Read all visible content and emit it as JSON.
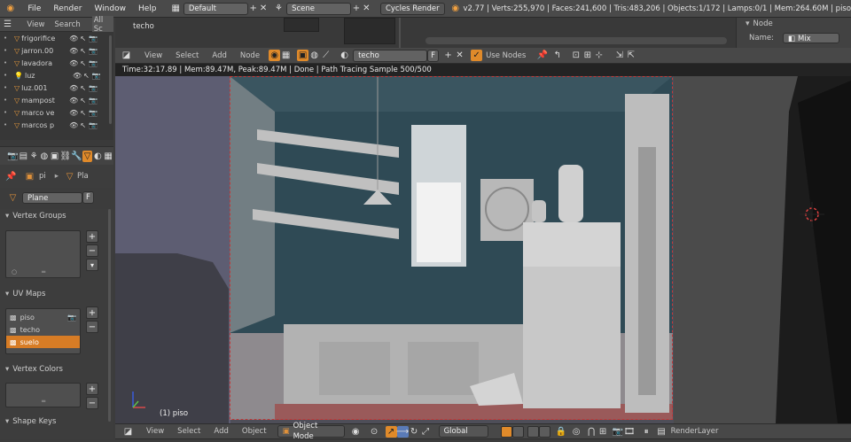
{
  "topbar": {
    "menus": [
      "File",
      "Render",
      "Window",
      "Help"
    ],
    "layout": "Default",
    "scene": "Scene",
    "engine": "Cycles Render",
    "stats": "v2.77 | Verts:255,970 | Faces:241,600 | Tris:483,206 | Objects:1/172 | Lamps:0/1 | Mem:264.60M | piso"
  },
  "outliner": {
    "menus": [
      "View",
      "Search",
      "All Sc"
    ],
    "items": [
      {
        "label": "frigorifice",
        "icon": "mesh-icon"
      },
      {
        "label": "jarron.00",
        "icon": "mesh-icon"
      },
      {
        "label": "lavadora",
        "icon": "mesh-icon"
      },
      {
        "label": "luz",
        "icon": "lamp-icon"
      },
      {
        "label": "luz.001",
        "icon": "mesh-icon"
      },
      {
        "label": "mampost",
        "icon": "mesh-icon"
      },
      {
        "label": "marco ve",
        "icon": "mesh-icon"
      },
      {
        "label": "marcos p",
        "icon": "mesh-icon"
      }
    ]
  },
  "properties": {
    "tab_labels": [
      "pi",
      "Pla"
    ],
    "object_name": "Plane",
    "fake_user": "F",
    "vertex_groups": "Vertex Groups",
    "uv_maps": "UV Maps",
    "uv_items": [
      {
        "label": "piso",
        "selected": false
      },
      {
        "label": "techo",
        "selected": false
      },
      {
        "label": "suelo",
        "selected": true
      }
    ],
    "vertex_colors": "Vertex Colors",
    "shape_keys": "Shape Keys"
  },
  "node_editor": {
    "node_label": "techo",
    "menus": [
      "View",
      "Select",
      "Add",
      "Node"
    ],
    "material": "techo",
    "fake_user": "F",
    "use_nodes": "Use Nodes",
    "side_title": "Node",
    "name_label": "Name:",
    "name_value": "Mix"
  },
  "render_status": "Time:32:17.89 | Mem:89.47M, Peak:89.47M | Done | Path Tracing Sample 500/500",
  "viewport": {
    "object_label": "(1) piso",
    "menus": [
      "View",
      "Select",
      "Add",
      "Object"
    ],
    "mode": "Object Mode",
    "orientation": "Global",
    "layer": "RenderLayer"
  },
  "colors": {
    "selected_item": "#d77c25",
    "render_wall": "#2e4a55",
    "render_floor": "#9a5a5a"
  }
}
